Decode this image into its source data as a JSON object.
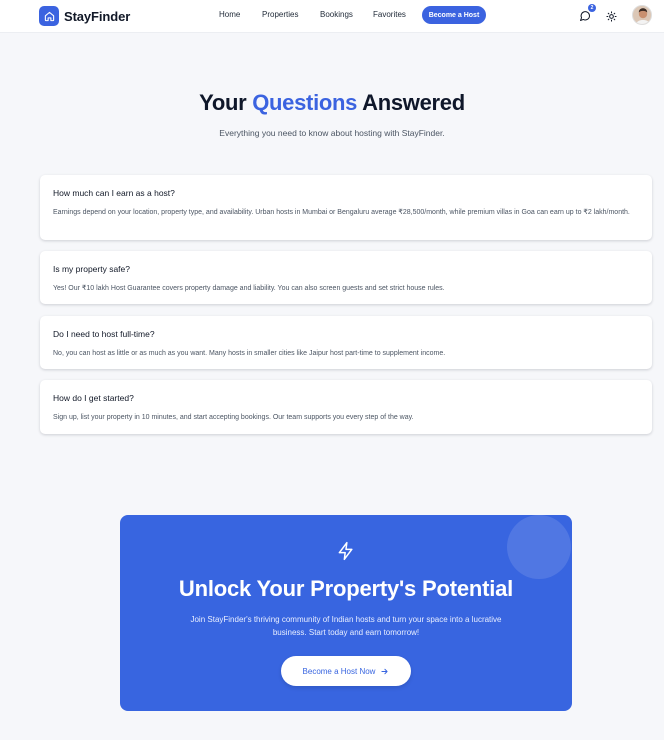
{
  "brand": {
    "name": "StayFinder",
    "color": "#3b63e0"
  },
  "nav": {
    "links": [
      "Home",
      "Properties",
      "Bookings",
      "Favorites"
    ],
    "cta_label": "Become a Host",
    "notification_count": "2",
    "icons": [
      "chat-icon",
      "theme-toggle-icon",
      "user-avatar"
    ]
  },
  "faq": {
    "title_prefix": "Your",
    "title_accent": "Questions",
    "title_suffix": "Answered",
    "subtitle": "Everything you need to know about hosting with StayFinder.",
    "items": [
      {
        "question": "How much can I earn as a host?",
        "answer": "Earnings depend on your location, property type, and availability. Urban hosts in Mumbai or Bengaluru average ₹28,500/month, while premium villas in Goa can earn up to ₹2 lakh/month."
      },
      {
        "question": "Is my property safe?",
        "answer": "Yes! Our ₹10 lakh Host Guarantee covers property damage and liability. You can also screen guests and set strict house rules."
      },
      {
        "question": "Do I need to host full-time?",
        "answer": "No, you can host as little or as much as you want. Many hosts in smaller cities like Jaipur host part-time to supplement income."
      },
      {
        "question": "How do I get started?",
        "answer": "Sign up, list your property in 10 minutes, and start accepting bookings. Our team supports you every step of the way."
      }
    ]
  },
  "cta": {
    "icon": "lightning-bolt-icon",
    "title": "Unlock Your Property's Potential",
    "text": "Join StayFinder's thriving community of Indian hosts and turn your space into a lucrative business. Start today and earn tomorrow!",
    "button_label": "Become a Host Now",
    "background": "#3865e0"
  }
}
